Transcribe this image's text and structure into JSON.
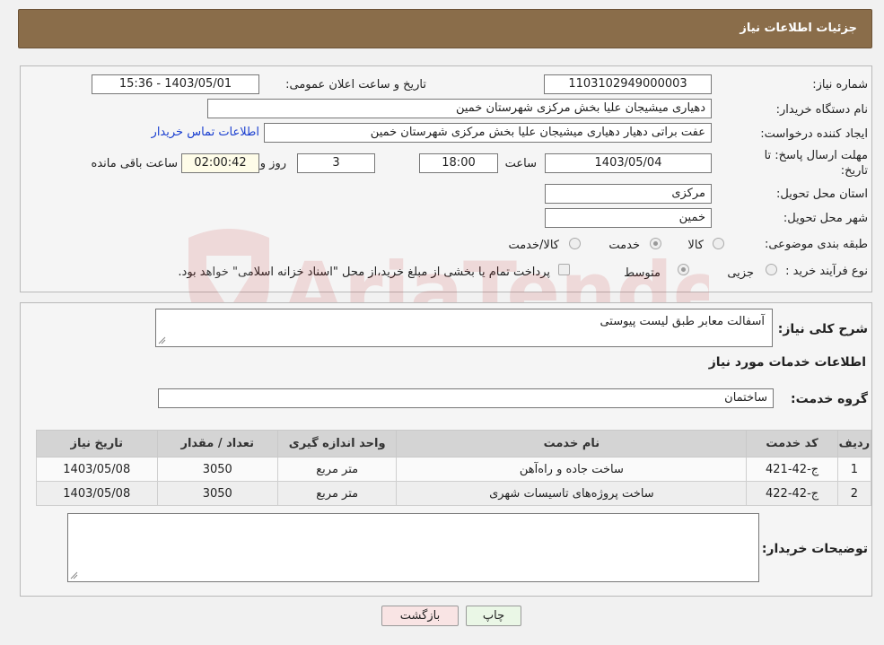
{
  "header": {
    "title": "جزئیات اطلاعات نیاز"
  },
  "form": {
    "need_number_label": "شماره نیاز:",
    "need_number": "1103102949000003",
    "announce_label": "تاریخ و ساعت اعلان عمومی:",
    "announce_value": "1403/05/01 - 15:36",
    "buyer_org_label": "نام دستگاه خریدار:",
    "buyer_org": "دهیاری میشیجان علیا بخش مرکزی شهرستان خمین",
    "creator_label": "ایجاد کننده درخواست:",
    "creator": "عفت براتی دهیار  دهیاری میشیجان علیا بخش مرکزی شهرستان خمین",
    "contact_link": "اطلاعات تماس خریدار",
    "deadline_label_1": "مهلت ارسال پاسخ: تا",
    "deadline_label_2": "تاریخ:",
    "deadline_date": "1403/05/04",
    "time_label": "ساعت",
    "deadline_time": "18:00",
    "days": "3",
    "days_label": "روز و",
    "remaining": "02:00:42",
    "remaining_label": "ساعت باقی مانده",
    "province_label": "استان محل تحویل:",
    "province": "مرکزی",
    "city_label": "شهر محل تحویل:",
    "city": "خمین",
    "category_label": "طبقه بندی موضوعی:",
    "category_options": [
      "کالا",
      "خدمت",
      "کالا/خدمت"
    ],
    "process_label": "نوع فرآیند خرید :",
    "process_options": [
      "جزیی",
      "متوسط"
    ],
    "process_note": "پرداخت تمام یا بخشی از مبلغ خرید،از محل \"اسناد خزانه اسلامی\" خواهد بود."
  },
  "watermark": {
    "text": "AriaTender.neT"
  },
  "details": {
    "summary_label": "شرح کلی نیاز:",
    "summary": "آسفالت معابر طبق لیست پیوستی",
    "services_heading": "اطلاعات خدمات مورد نیاز",
    "group_label": "گروه خدمت:",
    "group_value": "ساختمان",
    "table": {
      "headers": [
        "ردیف",
        "کد خدمت",
        "نام خدمت",
        "واحد اندازه گیری",
        "تعداد / مقدار",
        "تاریخ نیاز"
      ],
      "rows": [
        [
          "1",
          "ج-42-421",
          "ساخت جاده و راه‌آهن",
          "متر مربع",
          "3050",
          "1403/05/08"
        ],
        [
          "2",
          "ج-42-422",
          "ساخت پروژه‌های تاسیسات شهری",
          "متر مربع",
          "3050",
          "1403/05/08"
        ]
      ]
    },
    "buyer_notes_label": "توضیحات خریدار:"
  },
  "buttons": {
    "print": "چاپ",
    "back": "بازگشت"
  },
  "colors": {
    "header": "#8a6d4a",
    "link": "#1a3fd0",
    "print_btn": "#eaf7e6",
    "back_btn": "#f9e4e4"
  }
}
